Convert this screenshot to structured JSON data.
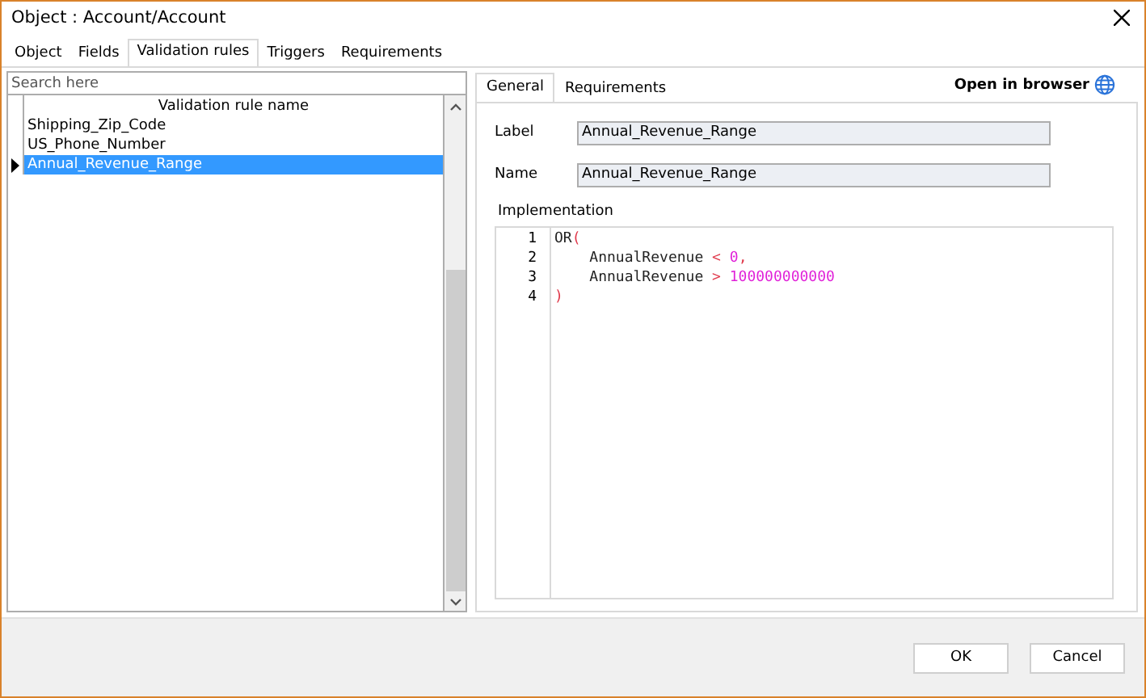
{
  "window": {
    "title": "Object : Account/Account"
  },
  "tabs": [
    {
      "label": "Object",
      "selected": false
    },
    {
      "label": "Fields",
      "selected": false
    },
    {
      "label": "Validation rules",
      "selected": true
    },
    {
      "label": "Triggers",
      "selected": false
    },
    {
      "label": "Requirements",
      "selected": false
    }
  ],
  "search": {
    "placeholder": "Search here"
  },
  "rules_table": {
    "columns": [
      "Validation rule name"
    ],
    "rows": [
      {
        "name": "Shipping_Zip_Code",
        "selected": false
      },
      {
        "name": "US_Phone_Number",
        "selected": false
      },
      {
        "name": "Annual_Revenue_Range",
        "selected": true
      }
    ]
  },
  "detail_tabs": [
    {
      "label": "General",
      "selected": true
    },
    {
      "label": "Requirements",
      "selected": false
    }
  ],
  "open_in_browser": "Open in browser",
  "fields": [
    {
      "label": "Label",
      "value": "Annual_Revenue_Range"
    },
    {
      "label": "Name",
      "value": "Annual_Revenue_Range"
    }
  ],
  "implementation": {
    "label": "Implementation",
    "lines": [
      {
        "number": "1",
        "tokens": [
          {
            "text": "OR",
            "kind": "plain"
          },
          {
            "text": "(",
            "kind": "operator"
          }
        ]
      },
      {
        "number": "2",
        "tokens": [
          {
            "text": "    AnnualRevenue ",
            "kind": "plain"
          },
          {
            "text": "<",
            "kind": "operator"
          },
          {
            "text": " 0",
            "kind": "number"
          },
          {
            "text": ",",
            "kind": "operator"
          }
        ]
      },
      {
        "number": "3",
        "tokens": [
          {
            "text": "    AnnualRevenue ",
            "kind": "plain"
          },
          {
            "text": ">",
            "kind": "operator"
          },
          {
            "text": " 100000000000",
            "kind": "number"
          }
        ]
      },
      {
        "number": "4",
        "tokens": [
          {
            "text": ")",
            "kind": "operator"
          }
        ]
      }
    ]
  },
  "buttons": [
    "OK",
    "Cancel"
  ]
}
